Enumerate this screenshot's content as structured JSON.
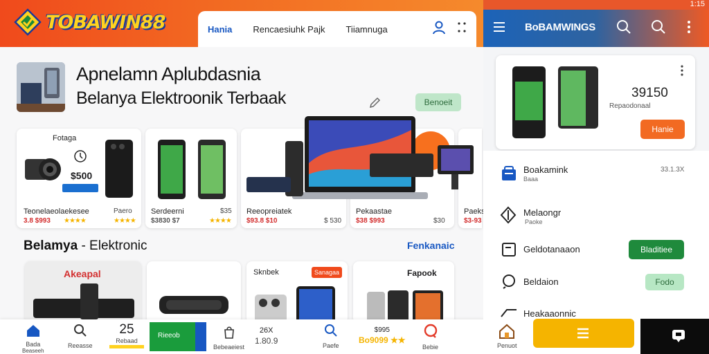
{
  "brand": {
    "logo_text": "TOBAWIN88",
    "accent": "#f26a22",
    "blue": "#1757c2",
    "green": "#1f8a3c"
  },
  "main_nav": {
    "links": [
      "Hania",
      "Rencaesiuhk Pajk",
      "Tiiamnuga"
    ],
    "user_icon": "user-icon",
    "more_icon": "more-vertical-icon"
  },
  "hero": {
    "title": "Apnelamn Aplubdasnia",
    "subtitle": "Belanya Elektroonik Terbaak",
    "action_label": "Benoeit",
    "edit_icon": "edit-icon"
  },
  "products": [
    {
      "category": "Fotaga",
      "badge": "$500",
      "name": "Teonelaeolaekesee",
      "price": "3.8 $993",
      "secondary": "Paero",
      "stars": "★★★★"
    },
    {
      "name": "Serdeerni",
      "price": "$3830 $7",
      "secondary": "$35",
      "stars": "★★★★"
    },
    {
      "name": "Reeopreiatek",
      "price": "$93.8 $10",
      "secondary": "$ 530",
      "stars": ""
    },
    {
      "name": "Pekaastae",
      "price": "$38 $993",
      "secondary": "$30",
      "stars": ""
    },
    {
      "name": "Paekse",
      "price": "$3-93",
      "secondary": "",
      "stars": ""
    }
  ],
  "section": {
    "title_bold": "Belamya",
    "title_rest": " - Elektronic",
    "link": "Fenkanaic"
  },
  "bottom_cards": [
    {
      "label": "Akeapal"
    },
    {
      "label": ""
    },
    {
      "label": "Sknbek",
      "badge": "Sanagaa"
    },
    {
      "label": "Fapook"
    }
  ],
  "bottom_nav": {
    "items": [
      {
        "label": "Bada",
        "sub": "Beaseeh",
        "icon": "home-icon"
      },
      {
        "label": "Reeasse",
        "icon": "search-icon"
      },
      {
        "label": "25",
        "sub": "Rebaad",
        "icon": "badge-icon"
      },
      {
        "label": "Rieeob",
        "icon": "promo-banner"
      },
      {
        "label": "Bebeaeiest",
        "icon": "bag-icon"
      },
      {
        "label": "1.80.9",
        "sub": "26X",
        "icon": "tag-icon"
      },
      {
        "label": "Paefe",
        "icon": "search-icon"
      },
      {
        "label": "Bo9099 ★★",
        "sub": "$995",
        "icon": "star-icon"
      },
      {
        "label": "Bebie",
        "icon": "chat-icon"
      }
    ]
  },
  "right_panel": {
    "status_time": "1:15",
    "title": "BoBAMWINGS",
    "card": {
      "price": "39150",
      "price_sub": "Repaodonaal",
      "button": "Hanie"
    },
    "rows": [
      {
        "title": "Boakamink",
        "sub": "Baaa",
        "meta": "33.1.3X",
        "icon": "cart-icon"
      },
      {
        "title": "Melaongr",
        "sub": "Paoke",
        "icon": "ticket-icon"
      },
      {
        "title": "Geldotanaaon",
        "button": "Bladitiee",
        "button_color": "#1f8a3c",
        "icon": "square-icon"
      },
      {
        "title": "Beldaion",
        "button": "Fodo",
        "button_color": "#b7e7c4",
        "icon": "search-alt-icon"
      },
      {
        "title": "Heakaaonnic",
        "icon": "truck-icon"
      }
    ],
    "bottom": {
      "home_label": "Penuot"
    }
  }
}
